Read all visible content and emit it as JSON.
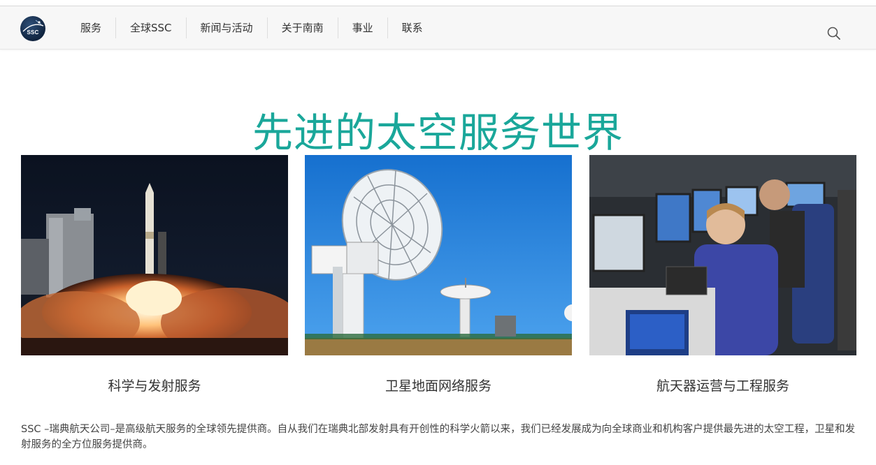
{
  "header": {
    "logo_text": "SSC",
    "nav": [
      "服务",
      "全球SSC",
      "新闻与活动",
      "关于南南",
      "事业",
      "联系"
    ]
  },
  "hero": {
    "title": "先进的太空服务世界"
  },
  "cards": [
    {
      "caption": "科学与发射服务"
    },
    {
      "caption": "卫星地面网络服务"
    },
    {
      "caption": "航天器运营与工程服务"
    }
  ],
  "intro": {
    "text": "SSC –瑞典航天公司–是高级航天服务的全球领先提供商。自从我们在瑞典北部发射具有开创性的科学火箭以来，我们已经发展成为向全球商业和机构客户提供最先进的太空工程，卫星和发射服务的全方位服务提供商。"
  },
  "colors": {
    "accent": "#1aa79a",
    "nav_bg": "#f7f7f7",
    "sky_blue": "#1f7fd6"
  },
  "icons": {
    "search": "search-icon",
    "logo": "ssc-logo-icon"
  }
}
